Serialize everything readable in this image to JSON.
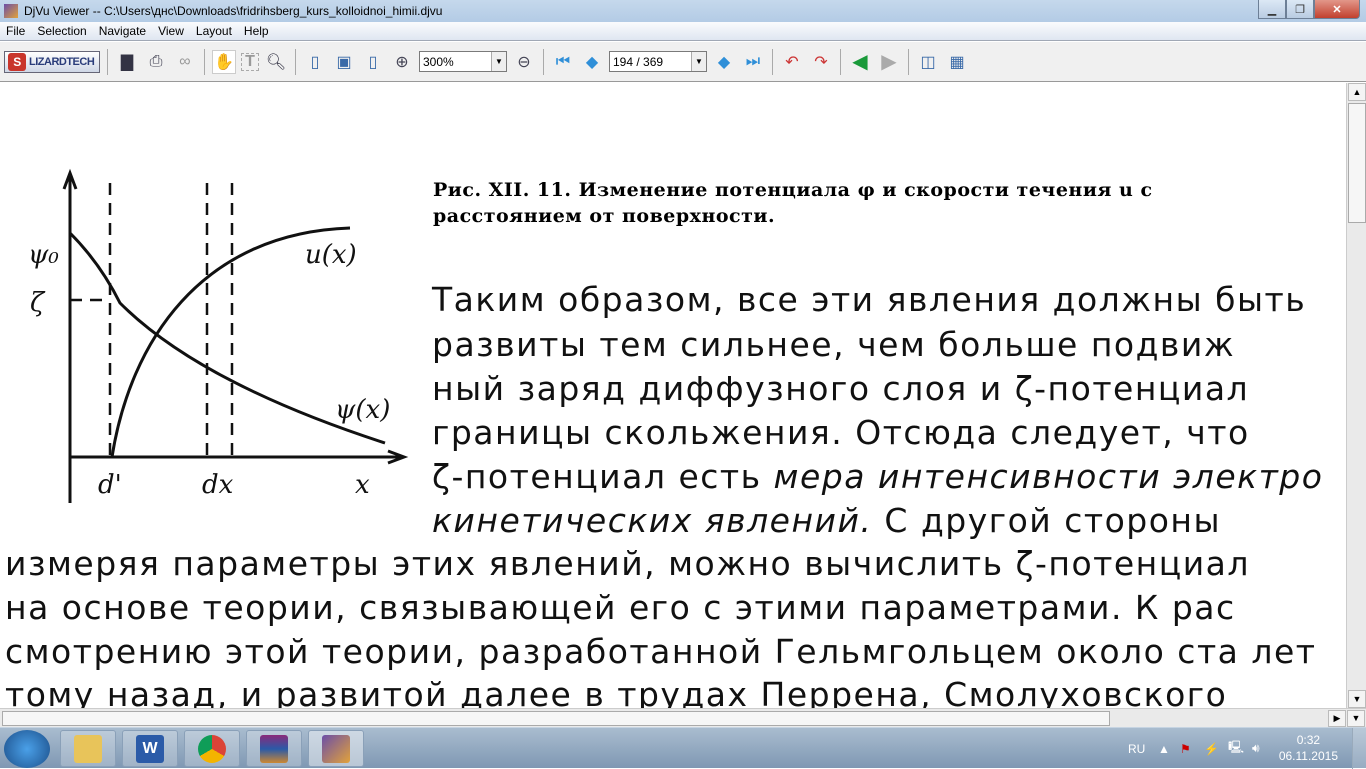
{
  "window": {
    "title": "DjVu Viewer -- C:\\Users\\днс\\Downloads\\fridrihsberg_kurs_kolloidnoi_himii.djvu"
  },
  "menu": [
    "File",
    "Selection",
    "Navigate",
    "View",
    "Layout",
    "Help"
  ],
  "toolbar": {
    "logo": "LIZARDTECH",
    "zoom": "300%",
    "page": "194 / 369"
  },
  "document": {
    "caption": [
      "Рис. XII. 11. Изменение потенциала φ  и скорости течения u  с",
      "расстоянием от поверхности."
    ],
    "figure_labels": {
      "psi0": "ψ₀",
      "zeta": "ζ",
      "ux": "u(x)",
      "psix": "ψ(x)",
      "d": "d'",
      "dx": "dx",
      "x": "x"
    },
    "lines_right": [
      "Таким образом, все эти явления должны быть",
      "развиты  тем  сильнее,  чем  больше  подвиж",
      "ный  заряд  диффузного  слоя  и  ζ-потенциал",
      "границы  скольжения.  Отсюда  следует,  что",
      "ζ-потенциал есть "
    ],
    "line5_italic": "мера интенсивности электро",
    "line6_italic": "кинетических   явлений.",
    "line6_rest": "  С  другой  стороны",
    "lines_full": [
      "измеряя параметры этих явлений, можно вычислить ζ-потенциал",
      "на основе теории, связывающей его с этими параметрами. К рас",
      "смотрению этой теории, разработанной Гельмгольцем около ста лет",
      "тому назад, и развитой далее в трудах Перрена, Смолуховского"
    ]
  },
  "tray": {
    "lang": "RU",
    "time": "0:32",
    "date": "06.11.2015"
  }
}
